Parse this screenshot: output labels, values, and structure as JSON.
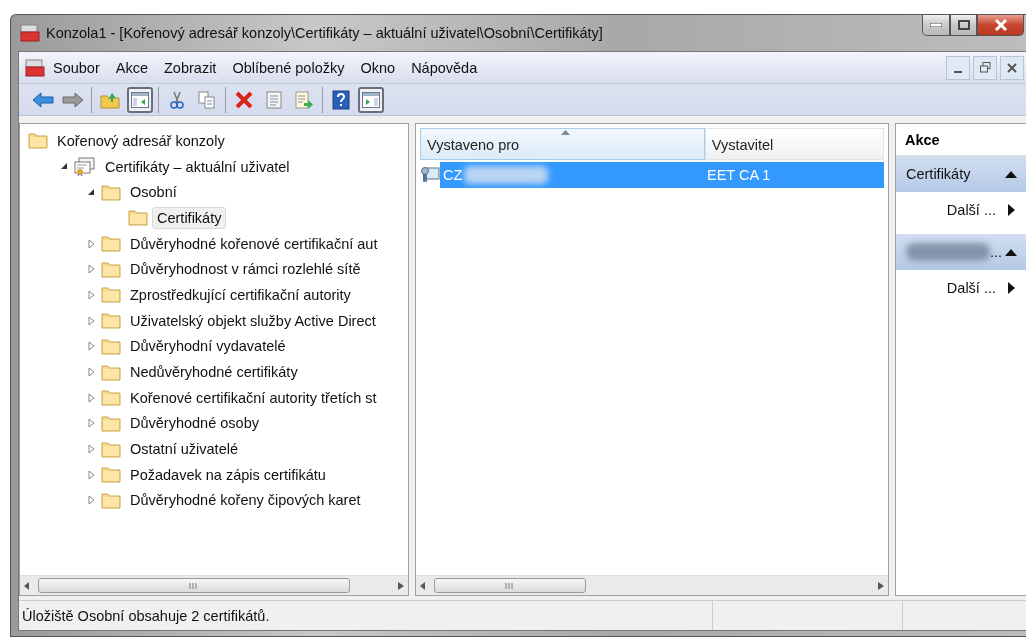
{
  "window": {
    "title": "Konzola1 - [Kořenový adresář konzoly\\Certifikáty – aktuální uživatel\\Osobní\\Certifikáty]"
  },
  "menu": [
    {
      "label": "Soubor"
    },
    {
      "label": "Akce"
    },
    {
      "label": "Zobrazit"
    },
    {
      "label": "Oblíbené položky"
    },
    {
      "label": "Okno"
    },
    {
      "label": "Nápověda"
    }
  ],
  "toolbar": [
    [
      {
        "kind": "back",
        "pressed": false
      },
      {
        "kind": "forward",
        "pressed": false
      }
    ],
    [
      {
        "kind": "up",
        "pressed": false
      },
      {
        "kind": "tree",
        "pressed": true
      }
    ],
    [
      {
        "kind": "cut",
        "pressed": false
      },
      {
        "kind": "copy",
        "pressed": false
      }
    ],
    [
      {
        "kind": "delete",
        "pressed": false
      },
      {
        "kind": "properties",
        "pressed": false
      },
      {
        "kind": "export",
        "pressed": false
      }
    ],
    [
      {
        "kind": "help",
        "pressed": false
      },
      {
        "kind": "actions",
        "pressed": true
      }
    ]
  ],
  "tree": [
    {
      "label": "Kořenový adresář konzoly",
      "kind": "folder",
      "selected": false,
      "children": [
        {
          "label": "Certifikáty – aktuální uživatel",
          "kind": "store",
          "selected": false,
          "expanded": true,
          "children": [
            {
              "label": "Osobní",
              "kind": "folder",
              "selected": false,
              "expanded": true,
              "children": [
                {
                  "label": "Certifikáty",
                  "kind": "folder",
                  "selected": true
                }
              ]
            },
            {
              "label": "Důvěryhodné kořenové certifikační aut",
              "kind": "folder",
              "selected": false,
              "expanded": false
            },
            {
              "label": "Důvěryhodnost v rámci rozlehlé sítě",
              "kind": "folder",
              "selected": false,
              "expanded": false
            },
            {
              "label": "Zprostředkující certifikační autority",
              "kind": "folder",
              "selected": false,
              "expanded": false
            },
            {
              "label": "Uživatelský objekt služby Active Direct",
              "kind": "folder",
              "selected": false,
              "expanded": false
            },
            {
              "label": "Důvěryhodní vydavatelé",
              "kind": "folder",
              "selected": false,
              "expanded": false
            },
            {
              "label": "Nedůvěryhodné certifikáty",
              "kind": "folder",
              "selected": false,
              "expanded": false
            },
            {
              "label": "Kořenové certifikační autority třetích st",
              "kind": "folder",
              "selected": false,
              "expanded": false
            },
            {
              "label": "Důvěryhodné osoby",
              "kind": "folder",
              "selected": false,
              "expanded": false
            },
            {
              "label": "Ostatní uživatelé",
              "kind": "folder",
              "selected": false,
              "expanded": false
            },
            {
              "label": "Požadavek na zápis certifikátu",
              "kind": "folder",
              "selected": false,
              "expanded": false
            },
            {
              "label": "Důvěryhodné kořeny čipových karet",
              "kind": "folder",
              "selected": false,
              "expanded": false
            }
          ]
        }
      ]
    }
  ],
  "table": {
    "columns": [
      {
        "label": "Vystaveno pro",
        "sorted": true
      },
      {
        "label": "Vystavitel",
        "sorted": false
      }
    ],
    "rows": [
      {
        "selected": true,
        "cells": [
          {
            "text": "CZ",
            "redacted": true
          },
          {
            "text": "EET CA 1",
            "redacted": false
          }
        ]
      }
    ]
  },
  "actions": {
    "title": "Akce",
    "sections": [
      {
        "title": "Certifikáty",
        "redacted": false,
        "expanded": true,
        "items": [
          "Další ..."
        ]
      },
      {
        "title": "...",
        "redacted": true,
        "expanded": true,
        "items": [
          "Další ..."
        ]
      }
    ]
  },
  "status_bar": {
    "text": "Úložiště Osobní obsahuje 2 certifikátů."
  }
}
